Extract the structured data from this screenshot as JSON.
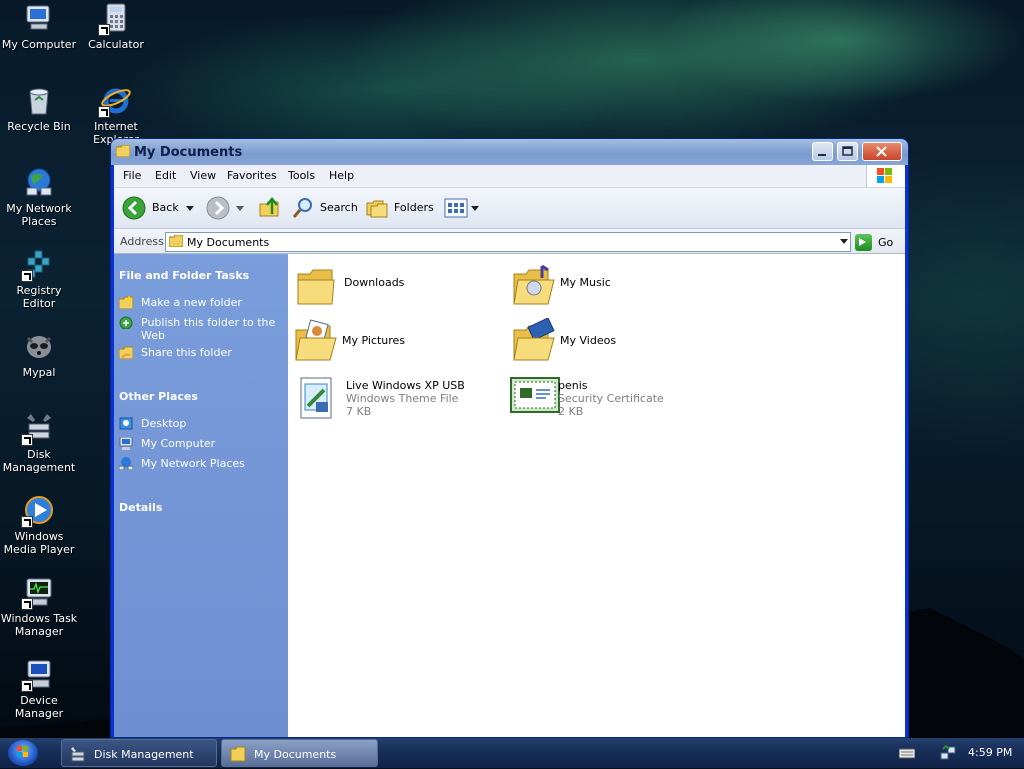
{
  "desktop": {
    "icons": [
      {
        "label": "My Computer"
      },
      {
        "label": "Calculator"
      },
      {
        "label": "Recycle Bin"
      },
      {
        "label": "Internet Explorer"
      },
      {
        "label": "My Network Places"
      },
      {
        "label": "Registry Editor"
      },
      {
        "label": "Mypal"
      },
      {
        "label": "Disk Management"
      },
      {
        "label": "Windows Media Player"
      },
      {
        "label": "Windows Task Manager"
      },
      {
        "label": "Device Manager"
      }
    ]
  },
  "window": {
    "title": "My Documents",
    "menu": [
      "File",
      "Edit",
      "View",
      "Favorites",
      "Tools",
      "Help"
    ],
    "toolbar": {
      "back": "Back",
      "search": "Search",
      "folders": "Folders"
    },
    "address": {
      "label": "Address",
      "value": "My Documents",
      "go": "Go"
    },
    "tasks": {
      "file_folder_heading": "File and Folder Tasks",
      "file_folder_links": [
        "Make a new folder",
        "Publish this folder to the Web",
        "Share this folder"
      ],
      "other_places_heading": "Other Places",
      "other_places_links": [
        "Desktop",
        "My Computer",
        "My Network Places"
      ],
      "details_heading": "Details"
    },
    "items": [
      {
        "name": "Downloads",
        "type": "",
        "size": "",
        "icon": "folder-icon"
      },
      {
        "name": "My Music",
        "type": "",
        "size": "",
        "icon": "music-folder-icon"
      },
      {
        "name": "My Pictures",
        "type": "",
        "size": "",
        "icon": "pictures-folder-icon"
      },
      {
        "name": "My Videos",
        "type": "",
        "size": "",
        "icon": "videos-folder-icon"
      },
      {
        "name": "Live Windows XP USB",
        "type": "Windows Theme File",
        "size": "7 KB",
        "icon": "theme-file-icon"
      },
      {
        "name": "penis",
        "type": "Security Certificate",
        "size": "2 KB",
        "icon": "certificate-icon"
      }
    ]
  },
  "taskbar": {
    "tasks": [
      {
        "label": "Disk Management",
        "active": false
      },
      {
        "label": "My Documents",
        "active": true
      }
    ],
    "clock": "4:59 PM"
  },
  "colors": {
    "taskpane": "#6e8fd2",
    "titlebar": "#8aa8d6",
    "taskbar": "#18305a"
  }
}
